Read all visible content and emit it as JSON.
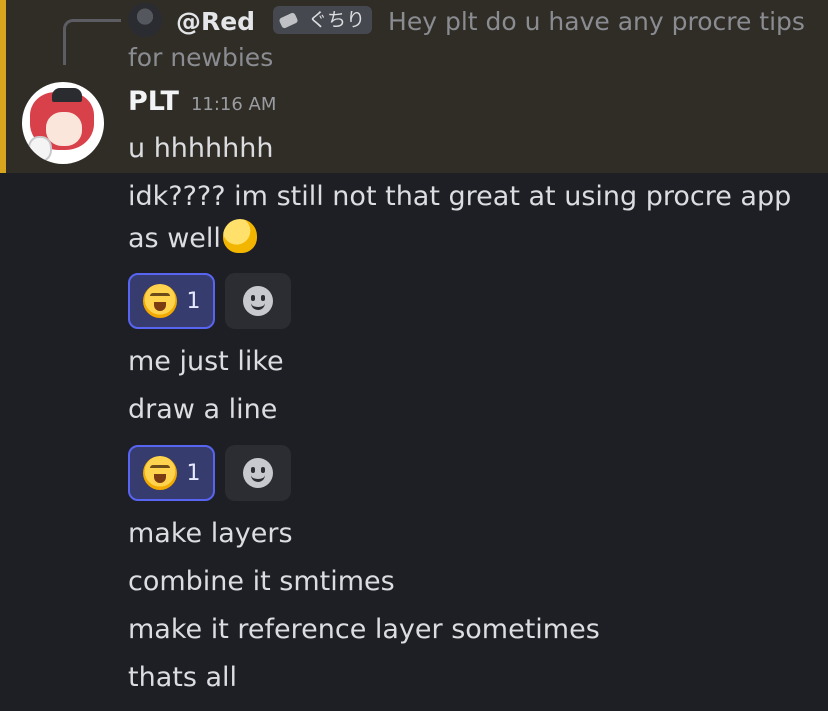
{
  "reply": {
    "author": "@Red",
    "role_tag": "ぐちり",
    "text": "Hey plt do u have any procre tips for newbies"
  },
  "message": {
    "author": "PLT",
    "timestamp": "11:16 AM"
  },
  "lines": {
    "l1": "u hhhhhhh",
    "l2": "idk???? im still not that great at using procre app as well",
    "l3": "me just like",
    "l4": "draw a line",
    "l5": "make layers",
    "l6": "combine it smtimes",
    "l7": "make it reference layer sometimes",
    "l8": "thats all"
  },
  "reactions": {
    "r1": {
      "emoji": "loudly-crying-face",
      "count": "1"
    },
    "r2": {
      "emoji": "loudly-crying-face",
      "count": "1"
    }
  },
  "icons": {
    "inline_emoji": "melting-face",
    "add_reaction": "smile-icon"
  },
  "colors": {
    "highlight_bg": "#302d27",
    "highlight_bar": "#d8a51f",
    "reaction_border": "#5865f2",
    "background": "#1e1f24"
  }
}
